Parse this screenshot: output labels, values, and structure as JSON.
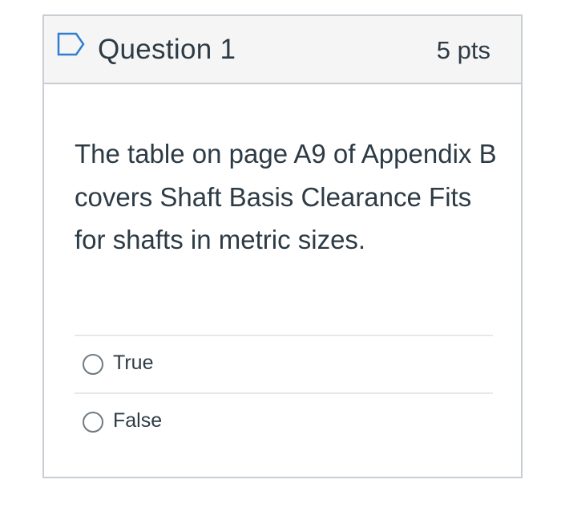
{
  "question": {
    "title": "Question 1",
    "points": "5 pts",
    "flag_icon": "flag-outline-icon",
    "text": "The table on page A9 of Appendix B covers Shaft Basis Clearance Fits for shafts in metric sizes."
  },
  "answers": [
    {
      "label": "True",
      "selected": false
    },
    {
      "label": "False",
      "selected": false
    }
  ],
  "colors": {
    "header_bg": "#f5f5f5",
    "border": "#c7cdd1",
    "text": "#2d3b45",
    "flag": "#2d7fd1",
    "radio": "#6f7a82"
  }
}
